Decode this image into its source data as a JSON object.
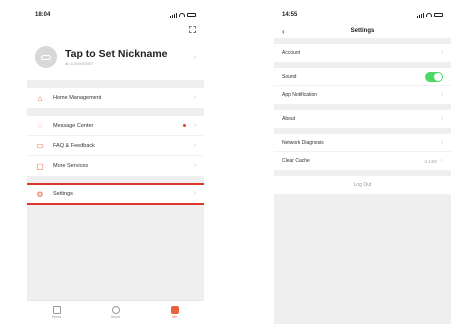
{
  "left": {
    "status": {
      "time": "18:04"
    },
    "profile": {
      "nickname": "Tap to Set Nickname",
      "uid": "ab-1285530907"
    },
    "menu_group_1": [
      {
        "label": "Home Management",
        "icon": "home-icon"
      }
    ],
    "menu_group_2": [
      {
        "label": "Message Center",
        "icon": "message-icon",
        "badge": true
      },
      {
        "label": "FAQ & Feedback",
        "icon": "faq-icon"
      },
      {
        "label": "More Services",
        "icon": "services-icon"
      }
    ],
    "menu_group_3": [
      {
        "label": "Settings",
        "icon": "gear-icon",
        "highlighted": true
      }
    ],
    "tabs": [
      {
        "label": "Home",
        "icon": "home-tab-icon"
      },
      {
        "label": "Smart",
        "icon": "smart-tab-icon"
      },
      {
        "label": "Me",
        "icon": "me-tab-icon",
        "active": true
      }
    ]
  },
  "right": {
    "status": {
      "time": "14:55"
    },
    "title": "Settings",
    "group_1": [
      {
        "label": "Account"
      }
    ],
    "group_2": [
      {
        "label": "Sound",
        "toggle": true
      },
      {
        "label": "App Notification"
      }
    ],
    "group_3": [
      {
        "label": "About"
      }
    ],
    "group_4": [
      {
        "label": "Network Diagnosis"
      },
      {
        "label": "Clear Cache",
        "value": "3.14M"
      }
    ],
    "logout": "Log Out"
  },
  "colors": {
    "accent": "#e8633c",
    "highlight": "#d9372a",
    "toggle_on": "#4cd964"
  }
}
